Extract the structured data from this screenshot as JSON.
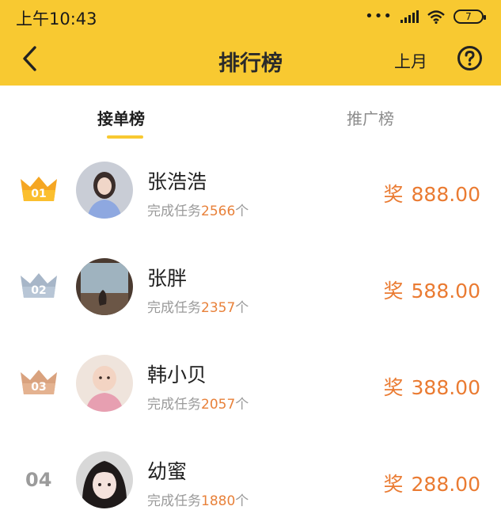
{
  "status_bar": {
    "time": "上午10:43",
    "battery": "7"
  },
  "nav": {
    "title": "排行榜",
    "month": "上月"
  },
  "tabs": [
    {
      "label": "接单榜"
    },
    {
      "label": "推广榜"
    }
  ],
  "ranking": [
    {
      "rank": "01",
      "name": "张浩浩",
      "task_prefix": "完成任务",
      "task_count": "2566",
      "task_suffix": "个",
      "reward_label": "奖",
      "reward": "888.00"
    },
    {
      "rank": "02",
      "name": "张胖",
      "task_prefix": "完成任务",
      "task_count": "2357",
      "task_suffix": "个",
      "reward_label": "奖",
      "reward": "588.00"
    },
    {
      "rank": "03",
      "name": "韩小贝",
      "task_prefix": "完成任务",
      "task_count": "2057",
      "task_suffix": "个",
      "reward_label": "奖",
      "reward": "388.00"
    },
    {
      "rank": "04",
      "name": "幼蜜",
      "task_prefix": "完成任务",
      "task_count": "1880",
      "task_suffix": "个",
      "reward_label": "奖",
      "reward": "288.00"
    }
  ],
  "icons": {
    "back": "chevron-left-icon",
    "help": "question-circle-icon",
    "wifi": "wifi-icon",
    "signal": "signal-icon",
    "battery": "battery-icon"
  },
  "colors": {
    "header": "#f8c931",
    "accent": "#ea7b32",
    "gold": "#f5a623",
    "silver": "#a7b6c8",
    "bronze": "#d9a27e"
  }
}
